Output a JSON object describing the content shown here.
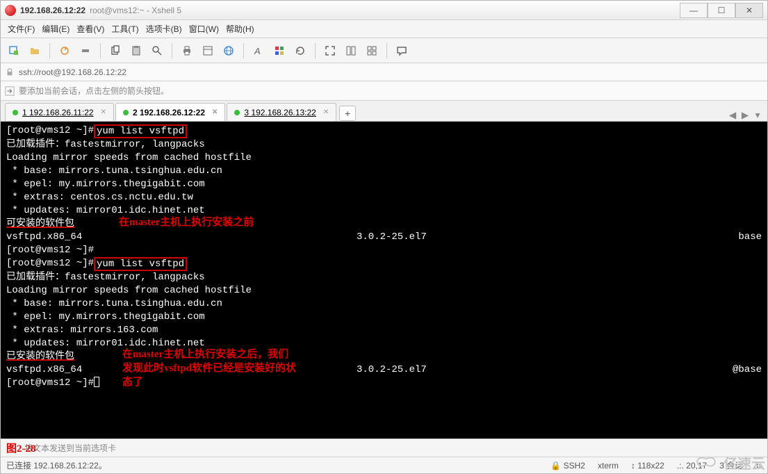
{
  "window": {
    "title_strong": "192.168.26.12:22",
    "title_rest": "root@vms12:~ - Xshell 5"
  },
  "menu": {
    "file": "文件(F)",
    "edit": "编辑(E)",
    "view": "查看(V)",
    "tools": "工具(T)",
    "tab": "选项卡(B)",
    "window": "窗口(W)",
    "help": "帮助(H)"
  },
  "toolbar_icons": {
    "new": "new-session-icon",
    "open": "open-icon",
    "copy": "copy-icon",
    "paste": "paste-icon",
    "find": "find-icon",
    "print": "print-icon",
    "properties": "properties-icon",
    "globe": "globe-icon",
    "font": "font-icon",
    "color": "color-icon",
    "refresh": "refresh-icon",
    "fullscreen": "fullscreen-icon",
    "tile": "tile-icon",
    "grid": "grid-icon",
    "chat": "chat-icon"
  },
  "addressbar": {
    "value": "ssh://root@192.168.26.12:22"
  },
  "hintbar": {
    "text": "要添加当前会话，点击左侧的箭头按钮。"
  },
  "tabs": [
    {
      "label": "1 192.168.26.11:22",
      "active": false
    },
    {
      "label": "2 192.168.26.12:22",
      "active": true
    },
    {
      "label": "3 192.168.26.13:22",
      "active": false
    }
  ],
  "terminal": {
    "prompt": "[root@vms12 ~]#",
    "cmd": "yum list vsftpd",
    "line_plugins": "已加载插件：fastestmirror, langpacks",
    "line_loading": "Loading mirror speeds from cached hostfile",
    "mirrors_before": [
      " * base: mirrors.tuna.tsinghua.edu.cn",
      " * epel: my.mirrors.thegigabit.com",
      " * extras: centos.cs.nctu.edu.tw",
      " * updates: mirror01.idc.hinet.net"
    ],
    "mirrors_after": [
      " * base: mirrors.tuna.tsinghua.edu.cn",
      " * epel: my.mirrors.thegigabit.com",
      " * extras: mirrors.163.com",
      " * updates: mirror01.idc.hinet.net"
    ],
    "avail_header": "可安装的软件包",
    "installed_header": "已安装的软件包",
    "pkg_name": "vsftpd.x86_64",
    "pkg_ver": "3.0.2-25.el7",
    "repo_avail": "base",
    "repo_installed": "@base",
    "anno_before": "在master主机上执行安装之前",
    "anno_after_l1": "在master主机上执行安装之后，我们",
    "anno_after_l2": "发现此时vsftpd软件已经是安装好的状",
    "anno_after_l3": "态了"
  },
  "footer1": {
    "hint": "将文本发送到当前选项卡",
    "figno": "图2-28"
  },
  "statusbar": {
    "conn": "已连接 192.168.26.12:22。",
    "proto": "SSH2",
    "term": "xterm",
    "size": "118x22",
    "pos": "20,17",
    "sessions": "3 会话"
  },
  "watermark": "亿速云"
}
